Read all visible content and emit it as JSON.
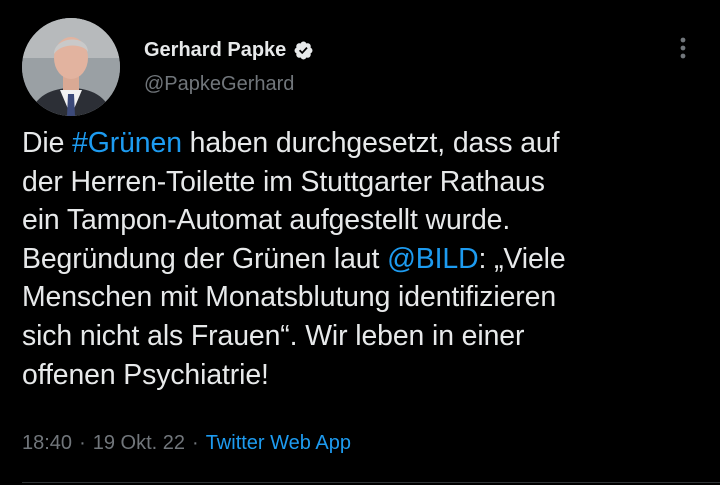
{
  "author": {
    "display_name": "Gerhard Papke",
    "handle": "@PapkeGerhard",
    "verified": true,
    "avatar_icon": "profile-photo"
  },
  "tweet": {
    "lines": [
      [
        {
          "text": "Die "
        },
        {
          "text": "#Grünen",
          "link": true
        },
        {
          "text": " haben durchgesetzt, dass auf"
        }
      ],
      [
        {
          "text": "der Herren-Toilette im Stuttgarter Rathaus"
        }
      ],
      [
        {
          "text": "ein Tampon-Automat aufgestellt wurde."
        }
      ],
      [
        {
          "text": "Begründung der Grünen laut "
        },
        {
          "text": "@BILD",
          "link": true
        },
        {
          "text": ": „Viele"
        }
      ],
      [
        {
          "text": "Menschen mit Monatsblutung identifizieren"
        }
      ],
      [
        {
          "text": "sich nicht als Frauen“. Wir leben in einer"
        }
      ],
      [
        {
          "text": "offenen Psychiatrie!"
        }
      ]
    ]
  },
  "meta": {
    "time": "18:40",
    "separator": "·",
    "date": "19 Okt. 22",
    "source": "Twitter Web App"
  },
  "icons": {
    "verified": "verified-badge-icon",
    "more": "more-options-icon"
  },
  "colors": {
    "background": "#000000",
    "text": "#e7e9ea",
    "secondary": "#71767b",
    "link": "#1d9bf0"
  }
}
